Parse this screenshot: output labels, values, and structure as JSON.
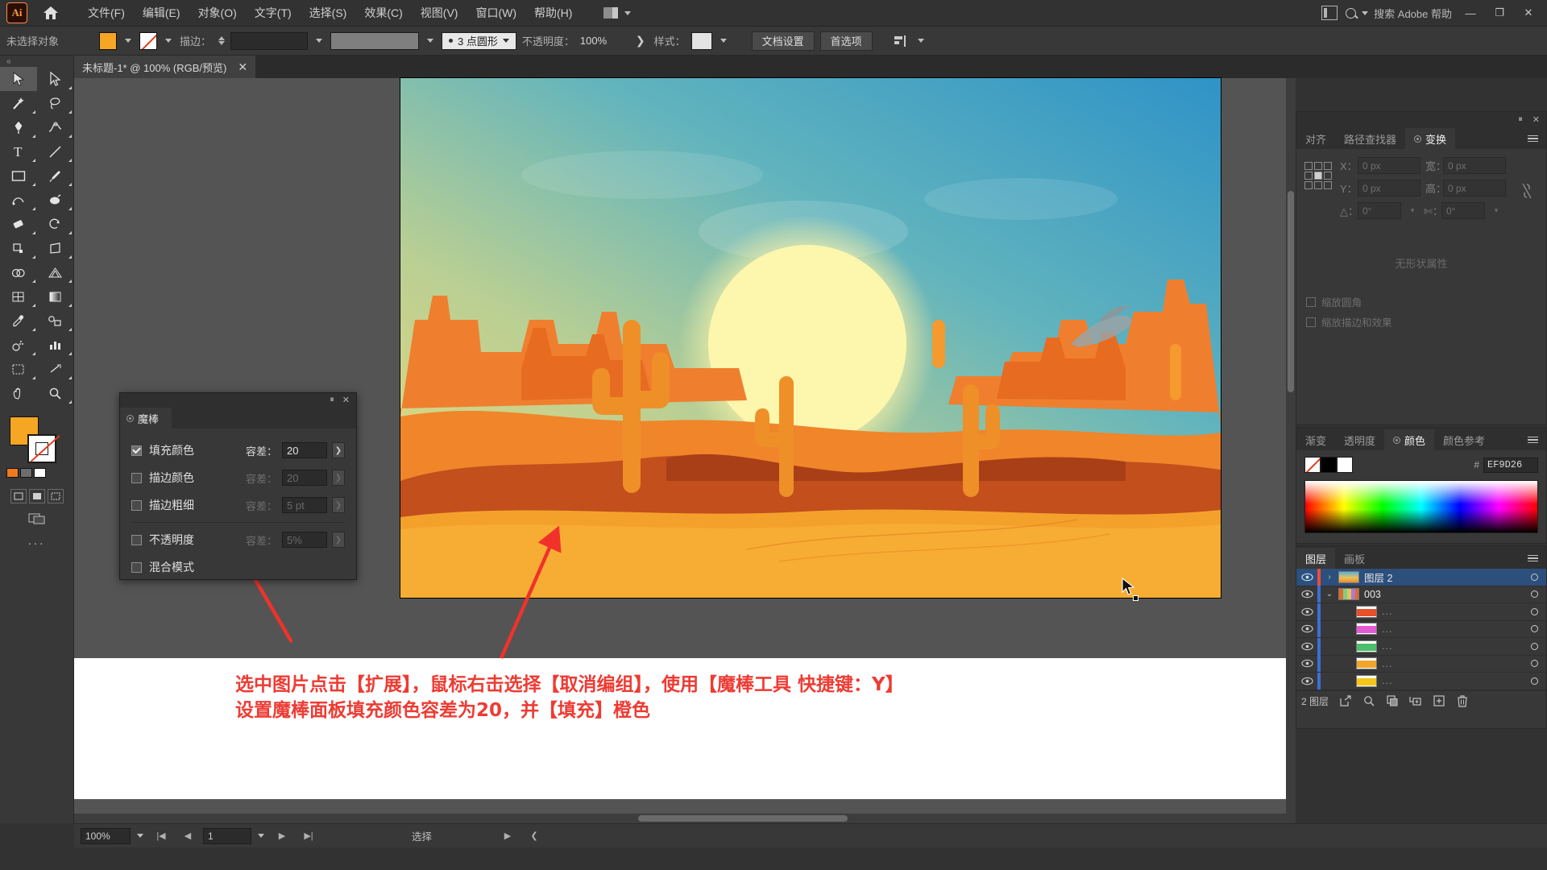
{
  "app": {
    "name": "Adobe Illustrator",
    "logo_text": "Ai"
  },
  "menubar": {
    "home_icon": "home-icon",
    "items": [
      {
        "label": "文件(F)"
      },
      {
        "label": "编辑(E)"
      },
      {
        "label": "对象(O)"
      },
      {
        "label": "文字(T)"
      },
      {
        "label": "选择(S)"
      },
      {
        "label": "效果(C)"
      },
      {
        "label": "视图(V)"
      },
      {
        "label": "窗口(W)"
      },
      {
        "label": "帮助(H)"
      }
    ],
    "search_placeholder": "搜索 Adobe 帮助",
    "window_buttons": {
      "minimize": "—",
      "restore": "❐",
      "close": "✕"
    }
  },
  "controlbar": {
    "selection_status": "未选择对象",
    "fill_color": "#F5A623",
    "stroke_color": "#FFFFFF",
    "stroke_label": "描边：",
    "stroke_weight": "",
    "profile_label": "3 点圆形",
    "opacity_label": "不透明度：",
    "opacity_value": "100%",
    "style_label": "样式：",
    "doc_setup_button": "文档设置",
    "preferences_button": "首选项"
  },
  "document_tab": {
    "title": "未标题-1* @ 100% (RGB/预览)",
    "close": "✕"
  },
  "toolbar": {
    "tools": [
      "selection-tool",
      "direct-selection-tool",
      "magic-wand-tool",
      "lasso-tool",
      "pen-tool",
      "curvature-tool",
      "type-tool",
      "line-segment-tool",
      "rectangle-tool",
      "paintbrush-tool",
      "shaper-tool",
      "blob-brush-tool",
      "eraser-tool",
      "rotate-tool",
      "scale-tool",
      "free-transform-tool",
      "shape-builder-tool",
      "perspective-grid-tool",
      "mesh-tool",
      "gradient-tool",
      "eyedropper-tool",
      "blend-tool",
      "symbol-sprayer-tool",
      "column-graph-tool",
      "artboard-tool",
      "slice-tool",
      "hand-tool",
      "zoom-tool"
    ],
    "fill_swatch": "#F5A623",
    "stroke_swatch": "#FFFFFF",
    "more_tools": "..."
  },
  "magic_wand_panel": {
    "tab_label": "魔棒",
    "close": "✕",
    "collapse": "⏸",
    "rows": [
      {
        "label": "填充颜色",
        "checked": true,
        "tol_label": "容差：",
        "tol_value": "20",
        "enabled": true
      },
      {
        "label": "描边颜色",
        "checked": false,
        "tol_label": "容差：",
        "tol_value": "20",
        "enabled": false
      },
      {
        "label": "描边粗细",
        "checked": false,
        "tol_label": "容差：",
        "tol_value": "5 pt",
        "enabled": false
      },
      {
        "label": "不透明度",
        "checked": false,
        "tol_label": "容差：",
        "tol_value": "5%",
        "enabled": false
      },
      {
        "label": "混合模式",
        "checked": false,
        "tol_label": "",
        "tol_value": "",
        "enabled": false
      }
    ]
  },
  "transform_panel": {
    "tabs": [
      {
        "label": "对齐",
        "active": false
      },
      {
        "label": "路径查找器",
        "active": false
      },
      {
        "label": "变换",
        "active": true
      }
    ],
    "fields": {
      "x_label": "X：",
      "x_value": "0 px",
      "y_label": "Y：",
      "y_value": "0 px",
      "w_label": "宽：",
      "w_value": "0 px",
      "h_label": "高：",
      "h_value": "0 px",
      "angle_label": "△：",
      "angle_value": "0°",
      "shear_label": "✄：",
      "shear_value": "0°"
    },
    "no_properties_text": "无形状属性",
    "checkboxes": [
      {
        "label": "缩放圆角"
      },
      {
        "label": "缩放描边和效果"
      }
    ]
  },
  "color_panel": {
    "tabs": [
      {
        "label": "渐变",
        "active": false
      },
      {
        "label": "透明度",
        "active": false
      },
      {
        "label": "颜色",
        "active": true
      },
      {
        "label": "颜色参考",
        "active": false
      }
    ],
    "hex_prefix": "#",
    "hex_value": "EF9D26",
    "swatches": [
      "none",
      "#000000",
      "#FFFFFF"
    ]
  },
  "layers_panel": {
    "tabs": [
      {
        "label": "图层",
        "active": true
      },
      {
        "label": "画板",
        "active": false
      }
    ],
    "rows": [
      {
        "name": "图层 2",
        "selected": true,
        "indent": 0,
        "color": "#ef4a3c",
        "expand": "›",
        "thumb": "sunset-thumb"
      },
      {
        "name": "003",
        "selected": false,
        "indent": 1,
        "color": "#3d6fd6",
        "expand": "⌄",
        "thumb": "group-thumb"
      },
      {
        "name": "...",
        "selected": false,
        "indent": 2,
        "color": "#3d6fd6",
        "expand": "",
        "thumb": "#e8502a"
      },
      {
        "name": "...",
        "selected": false,
        "indent": 2,
        "color": "#3d6fd6",
        "expand": "",
        "thumb": "#e45ad4"
      },
      {
        "name": "...",
        "selected": false,
        "indent": 2,
        "color": "#3d6fd6",
        "expand": "",
        "thumb": "#4bbf6a"
      },
      {
        "name": "...",
        "selected": false,
        "indent": 2,
        "color": "#3d6fd6",
        "expand": "",
        "thumb": "#f0a62a"
      },
      {
        "name": "...",
        "selected": false,
        "indent": 2,
        "color": "#3d6fd6",
        "expand": "",
        "thumb": "#f5c518"
      }
    ],
    "footer": {
      "count_text": "2 图层",
      "icons": [
        "release-to-layers-icon",
        "locate-object-icon",
        "create-sublayer-icon",
        "make-clipping-mask-icon",
        "new-layer-icon",
        "delete-layer-icon"
      ]
    }
  },
  "annotation": {
    "line1": "选中图片点击【扩展】，鼠标右击选择【取消编组】，使用【魔棒工具 快捷键：Y】",
    "line2": "设置魔棒面板填充颜色容差为20，并【填充】橙色",
    "color": "#EE3B33"
  },
  "statusbar": {
    "zoom": "100%",
    "page": "1",
    "tool_name": "选择",
    "nav_first": "|◀",
    "nav_prev": "◀",
    "nav_next": "▶",
    "nav_last": "▶|"
  },
  "artwork": {
    "description": "desert-sunset-illustration",
    "sky_top": "#3d9ac9",
    "sky_mid": "#7fc0c0",
    "sky_low": "#d8d27a",
    "sun": "#fdf3a8",
    "sand": "#f5a42a",
    "mesa": "#e8722a",
    "dune_dark": "#b5441c",
    "cactus": "#f0922a"
  }
}
